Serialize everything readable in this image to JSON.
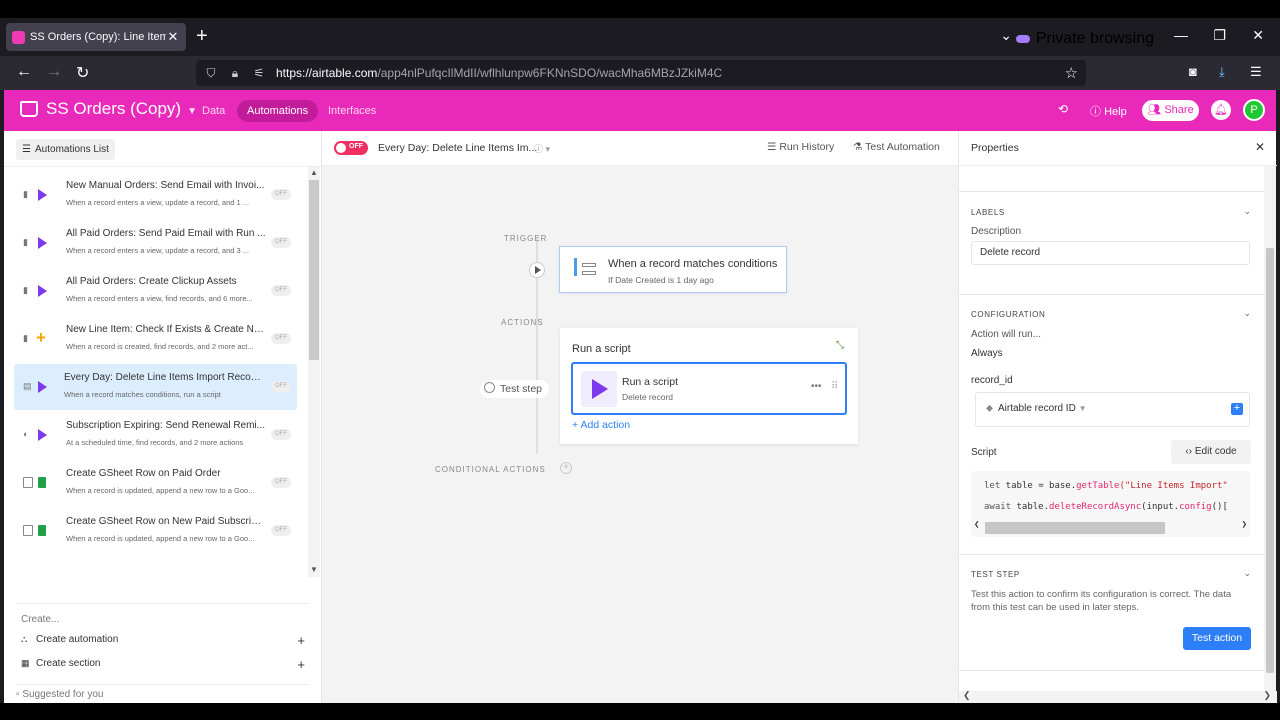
{
  "browser": {
    "tab_title": "SS Orders (Copy): Line Items Im",
    "tab_close": "✕",
    "new_tab": "+",
    "private_label": "Private browsing",
    "url_host": "https://airtable.com",
    "url_path": "/app4nlPufqcIlMdII/wflhlunpw6FKNnSDO/wacMha6MBzJZkiM4C"
  },
  "app": {
    "base_name": "SS Orders (Copy)",
    "nav": {
      "data": "Data",
      "automations": "Automations",
      "interfaces": "Interfaces"
    },
    "help": "Help",
    "share": "Share",
    "avatar_initial": "P",
    "brand_color": "#e929ba"
  },
  "sidebar": {
    "list_button": "Automations List",
    "items": [
      {
        "title": "New Manual Orders: Send Email with Invoi...",
        "subtitle": "When a record enters a view, update a record, and 1 ...",
        "status": "OFF",
        "icon": "play-icon"
      },
      {
        "title": "All Paid Orders: Send Paid Email with Run ...",
        "subtitle": "When a record enters a view, update a record, and 3 ...",
        "status": "OFF",
        "icon": "play-icon"
      },
      {
        "title": "All Paid Orders: Create Clickup Assets",
        "subtitle": "When a record enters a view, find records, and 6 more...",
        "status": "OFF",
        "icon": "play-icon"
      },
      {
        "title": "New Line Item: Check If Exists & Create New",
        "subtitle": "When a record is created, find records, and 2 more act...",
        "status": "OFF",
        "icon": "plus-icon"
      },
      {
        "title": "Every Day: Delete Line Items Import Records",
        "subtitle": "When a record matches conditions, run a script",
        "status": "OFF",
        "icon": "play-icon"
      },
      {
        "title": "Subscription Expiring: Send Renewal Remi...",
        "subtitle": "At a scheduled time, find records, and 2 more actions",
        "status": "OFF",
        "icon": "play-icon"
      },
      {
        "title": "Create GSheet Row on Paid Order",
        "subtitle": "When a record is updated, append a new row to a Goo...",
        "status": "OFF",
        "icon": "gsheet-icon"
      },
      {
        "title": "Create GSheet Row on New Paid Subscripti...",
        "subtitle": "When a record is updated, append a new row to a Goo...",
        "status": "OFF",
        "icon": "gsheet-icon"
      }
    ],
    "create_label": "Create...",
    "create_automation": "Create automation",
    "create_section": "Create section",
    "suggested": "Suggested for you"
  },
  "canvas": {
    "toggle_label": "OFF",
    "automation_name": "Every Day: Delete Line Items Im...",
    "run_history": "Run History",
    "test_automation": "Test Automation",
    "trigger_label": "TRIGGER",
    "actions_label": "ACTIONS",
    "conditional_label": "CONDITIONAL ACTIONS",
    "trigger_title": "When a record matches conditions",
    "trigger_sub": "If Date Created is 1 day ago",
    "card_title": "Run a script",
    "action_title": "Run a script",
    "action_sub": "Delete record",
    "add_action": "Add action",
    "test_step": "Test step"
  },
  "properties": {
    "title": "Properties",
    "labels_heading": "LABELS",
    "description_label": "Description",
    "description_value": "Delete record",
    "config_heading": "CONFIGURATION",
    "action_will_run": "Action will run...",
    "always": "Always",
    "record_id_label": "record_id",
    "record_id_value": "Airtable record ID",
    "script_label": "Script",
    "edit_code": "Edit code",
    "code_line1_kw": "let",
    "code_line1_var": " table = base.",
    "code_line1_fn": "getTable",
    "code_line1_str": "(\"Line Items Import\"",
    "code_line2_kw": "await",
    "code_line2_var": " table.",
    "code_line2_fn": "deleteRecordAsync",
    "code_line2_rest": "(input.",
    "code_line2_fn2": "config",
    "code_line2_end": "()[",
    "test_heading": "TEST STEP",
    "test_text": "Test this action to confirm its configuration is correct. The data from this test can be used in later steps.",
    "test_button": "Test action"
  }
}
